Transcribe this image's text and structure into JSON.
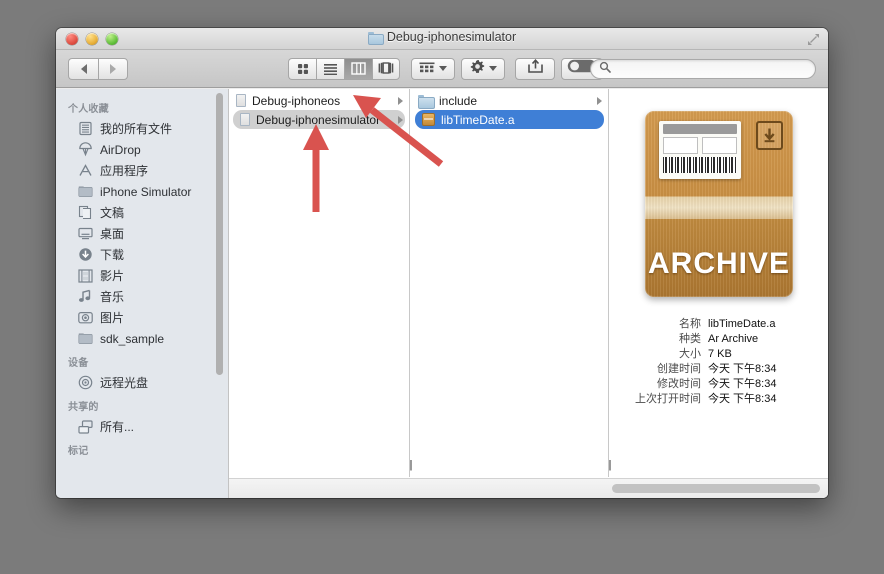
{
  "window": {
    "title": "Debug-iphonesimulator",
    "title_icon": "folder-icon",
    "traffic_lights": [
      "close-button",
      "minimize-button",
      "zoom-button"
    ],
    "expand_icon": "fullscreen-expand-icon"
  },
  "toolbar": {
    "back_icon": "back-arrow-icon",
    "forward_icon": "forward-arrow-icon",
    "views": [
      {
        "name": "icon-view",
        "icon": "grid-icon",
        "active": false
      },
      {
        "name": "list-view",
        "icon": "list-lines-icon",
        "active": false
      },
      {
        "name": "column-view",
        "icon": "columns-icon",
        "active": true
      },
      {
        "name": "coverflow-view",
        "icon": "coverflow-icon",
        "active": false
      }
    ],
    "arrange_icon": "arrange-grid-icon",
    "action_icon": "gear-icon",
    "share_icon": "share-arrow-icon",
    "dropbox_icon": "toggle-pill-icon"
  },
  "search": {
    "placeholder": "",
    "value": "",
    "icon": "search-icon"
  },
  "sidebar": {
    "scrollbar": "sidebar-scrollbar",
    "sections": [
      {
        "header": "个人收藏",
        "items": [
          {
            "label": "我的所有文件",
            "icon": "all-my-files-icon"
          },
          {
            "label": "AirDrop",
            "icon": "airdrop-icon"
          },
          {
            "label": "应用程序",
            "icon": "applications-icon"
          },
          {
            "label": "iPhone Simulator",
            "icon": "folder-icon"
          },
          {
            "label": "文稿",
            "icon": "documents-icon"
          },
          {
            "label": "桌面",
            "icon": "desktop-icon"
          },
          {
            "label": "下载",
            "icon": "downloads-icon"
          },
          {
            "label": "影片",
            "icon": "movies-icon"
          },
          {
            "label": "音乐",
            "icon": "music-icon"
          },
          {
            "label": "图片",
            "icon": "pictures-icon"
          },
          {
            "label": "sdk_sample",
            "icon": "folder-icon"
          }
        ]
      },
      {
        "header": "设备",
        "items": [
          {
            "label": "远程光盘",
            "icon": "remote-disc-icon"
          }
        ]
      },
      {
        "header": "共享的",
        "items": [
          {
            "label": "所有...",
            "icon": "network-icon"
          }
        ]
      },
      {
        "header": "标记",
        "items": []
      }
    ]
  },
  "columns": [
    {
      "name": "column-1",
      "rows": [
        {
          "label": "Debug-iphoneos",
          "icon": "doc-icon",
          "selected": false,
          "has_disclosure": true
        },
        {
          "label": "Debug-iphonesimulator",
          "icon": "doc-icon",
          "selected": true,
          "has_disclosure": true
        }
      ]
    },
    {
      "name": "column-2",
      "rows": [
        {
          "label": "include",
          "icon": "folder-icon",
          "selected": false,
          "has_disclosure": true
        },
        {
          "label": "libTimeDate.a",
          "icon": "archive-icon",
          "selected": true,
          "has_disclosure": false
        }
      ]
    }
  ],
  "preview": {
    "icon_name": "archive-box-icon",
    "icon_word": "ARCHIVE",
    "metadata": [
      {
        "key": "名称",
        "value": "libTimeDate.a"
      },
      {
        "key": "种类",
        "value": "Ar Archive"
      },
      {
        "key": "大小",
        "value": "7 KB"
      },
      {
        "key": "创建时间",
        "value": "今天 下午8:34"
      },
      {
        "key": "修改时间",
        "value": "今天 下午8:34"
      },
      {
        "key": "上次打开时间",
        "value": "今天 下午8:34"
      }
    ]
  },
  "annotations": [
    {
      "name": "red-arrow-vertical",
      "points_to": "Debug-iphonesimulator",
      "color": "#d9534f"
    },
    {
      "name": "red-arrow-diagonal",
      "points_to": "column-divider",
      "color": "#d9534f"
    }
  ],
  "colors": {
    "selection_blue": "#3f7fd6",
    "selection_gray": "#d0d0d0",
    "annotation_red": "#d9534f",
    "desktop": "#7b7b7b"
  }
}
